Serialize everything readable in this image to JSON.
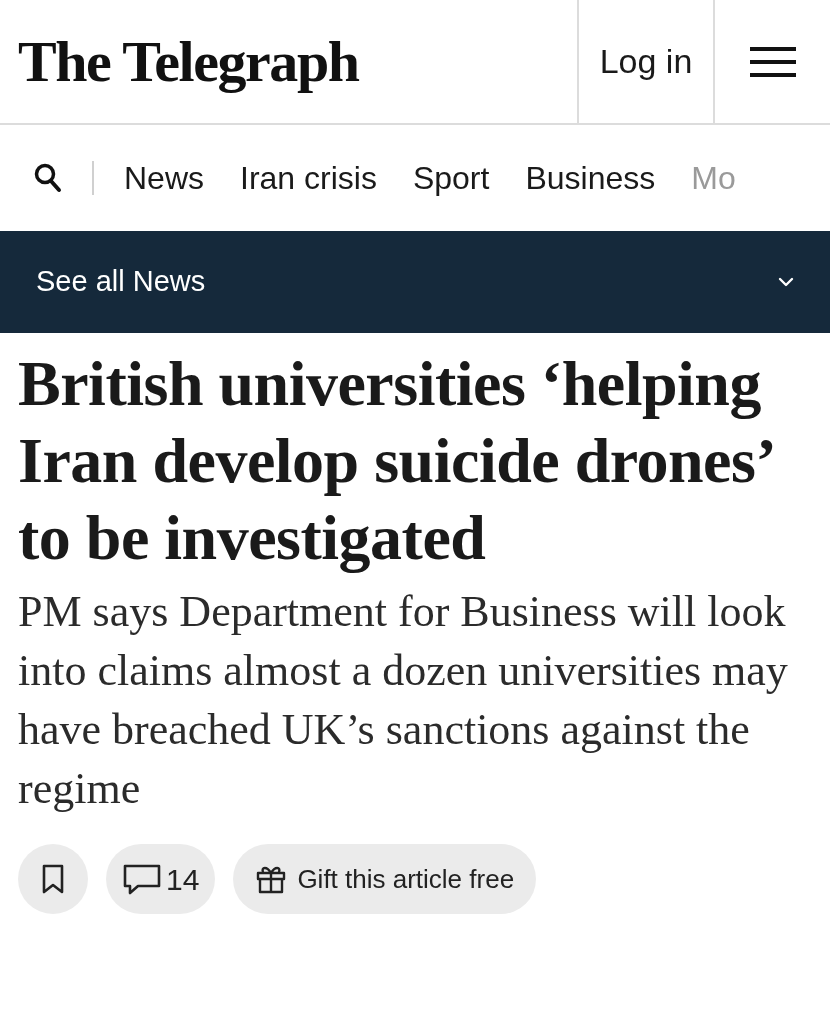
{
  "header": {
    "logo": "The Telegraph",
    "login": "Log in"
  },
  "nav": {
    "items": [
      {
        "label": "News"
      },
      {
        "label": "Iran crisis"
      },
      {
        "label": "Sport"
      },
      {
        "label": "Business"
      },
      {
        "label": "Mo"
      }
    ]
  },
  "section_bar": {
    "label": "See all News",
    "expanded": false
  },
  "article": {
    "headline": "British universities ‘helping Iran develop suicide drones’ to be investigated",
    "standfirst": "PM says Department for Business will look into claims almost a dozen universities may have breached UK’s sanctions against the regime",
    "comments": "14",
    "gift": "Gift this article free"
  }
}
